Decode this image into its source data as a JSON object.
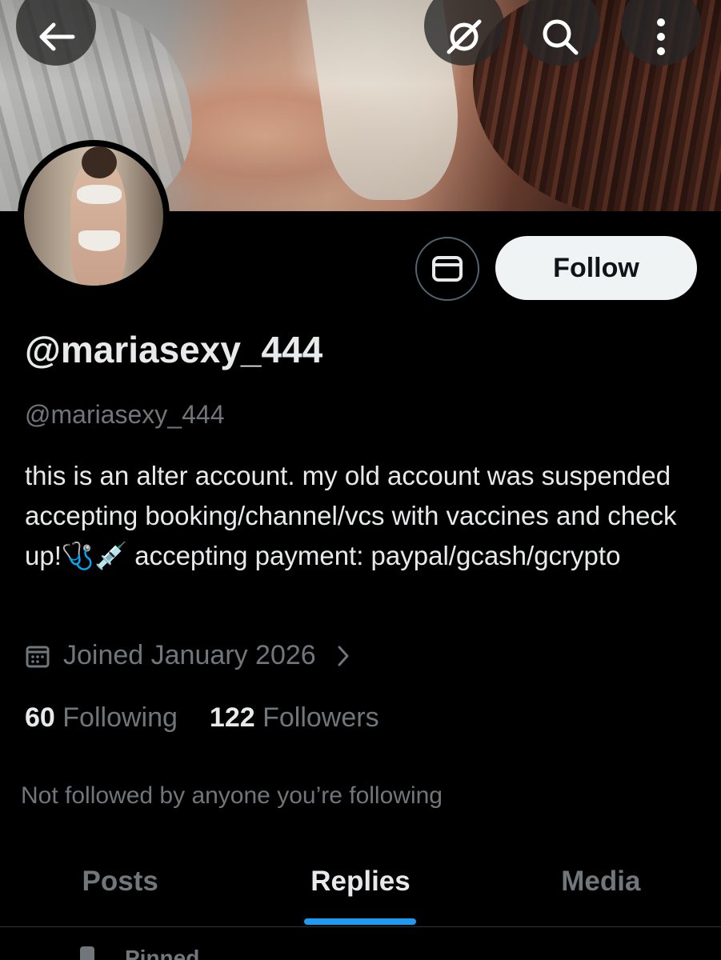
{
  "header": {
    "back_icon": "arrow-left-icon",
    "grok_icon": "grok-icon",
    "search_icon": "search-icon",
    "more_icon": "more-vertical-icon"
  },
  "profile": {
    "display_name": "@mariasexy_444",
    "handle": "@mariasexy_444",
    "bio": "this is an alter account. my old account was suspended accepting booking/channel/vcs with vaccines and check up!🩺💉 accepting payment: paypal/gcash/gcrypto",
    "joined": "Joined January 2026",
    "following_count": "60",
    "following_label": "Following",
    "followers_count": "122",
    "followers_label": "Followers",
    "not_followed_text": "Not followed by anyone you’re following"
  },
  "actions": {
    "message_icon": "mail-icon",
    "follow_label": "Follow"
  },
  "tabs": [
    {
      "label": "Posts",
      "active": false
    },
    {
      "label": "Replies",
      "active": true
    },
    {
      "label": "Media",
      "active": false
    }
  ],
  "pinned_label": "Pinned",
  "colors": {
    "accent": "#1d9bf0",
    "background": "#000000",
    "text_primary": "#e7e9ea",
    "text_secondary": "#71767b",
    "follow_bg": "#eff3f4"
  }
}
